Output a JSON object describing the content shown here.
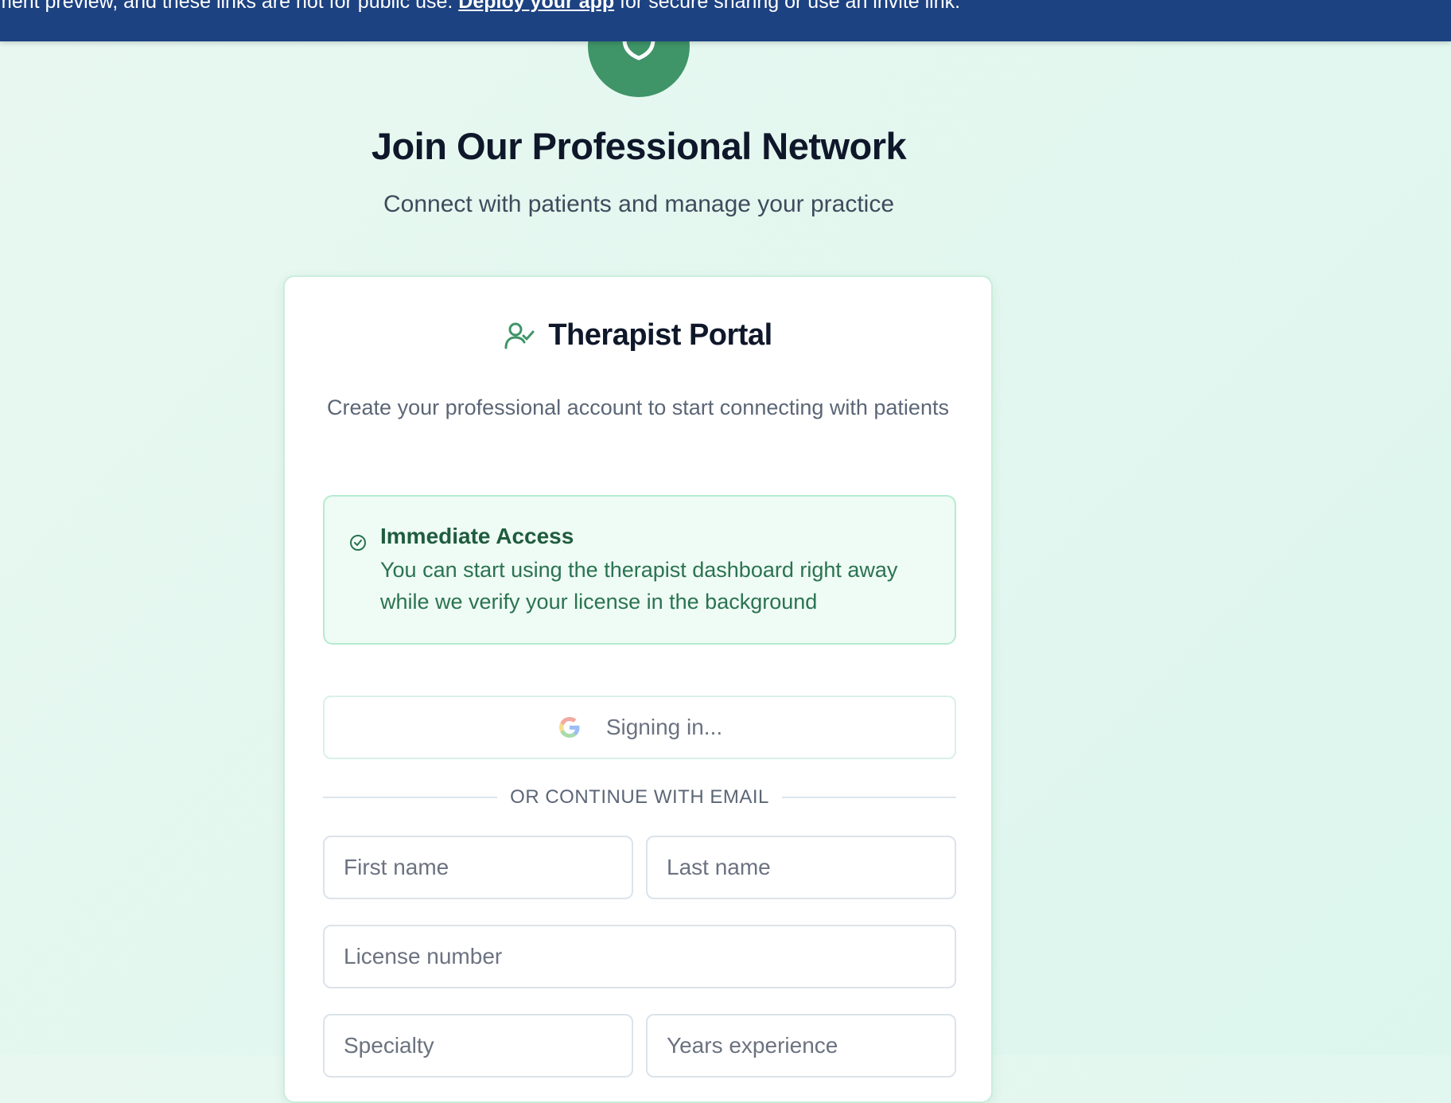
{
  "banner": {
    "text_before": "ment preview, and these links are not for public use. ",
    "link_text": "Deploy your app",
    "text_after": " for secure sharing or use an invite link."
  },
  "hero": {
    "logo_icon": "shield-icon",
    "title": "Join Our Professional Network",
    "subtitle": "Connect with patients and manage your practice"
  },
  "card": {
    "header_icon": "user-check-icon",
    "title": "Therapist Portal",
    "description": "Create your professional account to start connecting with patients",
    "notice": {
      "icon": "check-circle-icon",
      "title": "Immediate Access",
      "body": "You can start using the therapist dashboard right away while we verify your license in the background"
    },
    "google_button": {
      "icon": "google-icon",
      "label": "Signing in..."
    },
    "divider_text": "OR CONTINUE WITH EMAIL",
    "fields": {
      "first_name": {
        "placeholder": "First name",
        "value": ""
      },
      "last_name": {
        "placeholder": "Last name",
        "value": ""
      },
      "license_number": {
        "placeholder": "License number",
        "value": ""
      },
      "specialty": {
        "placeholder": "Specialty",
        "value": ""
      },
      "years_experience": {
        "placeholder": "Years experience",
        "value": ""
      }
    }
  },
  "colors": {
    "banner_bg": "#1d4282",
    "brand_green": "#3f9468",
    "notice_bg": "#effbf5",
    "notice_border": "#b5ebcf",
    "notice_text": "#2a7350"
  }
}
